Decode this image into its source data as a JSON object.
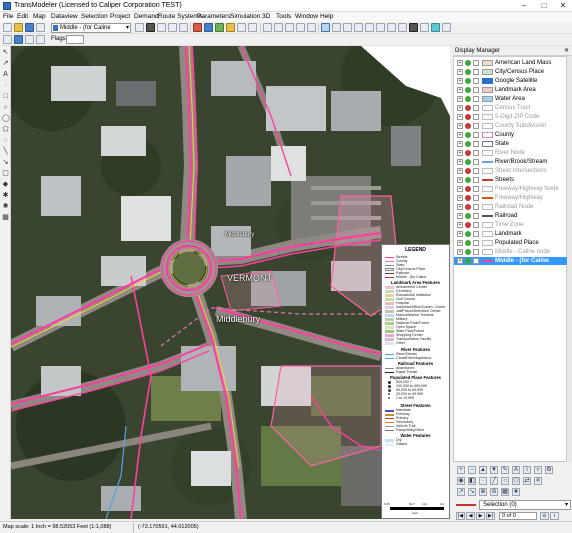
{
  "app": {
    "title": "TransModeler (Licensed to Caliper Corporation TEST)"
  },
  "menu": [
    "File",
    "Edit",
    "Map",
    "Dataview",
    "Selection",
    "Project",
    "Demand",
    "Route Systems",
    "Parameters",
    "Simulation",
    "3D",
    "Tools",
    "Window",
    "Help"
  ],
  "toolbar": {
    "layer_selected": "Middle - (for Caline",
    "flags_label": "Flags:"
  },
  "map": {
    "labels": {
      "vermont": "VERMONT",
      "middlebury": "Middlebury",
      "midbury_small": "Middlebury"
    }
  },
  "legend": {
    "title": "LEGEND",
    "top_items": [
      "Streets",
      "County",
      "State",
      "City/Census Place",
      "Railroad",
      "Middle - (for Caline"
    ],
    "landmark_title": "Landmark Area Features",
    "landmark_items": [
      "Amusement Center",
      "Cemetery",
      "Educational Institution",
      "Golf Course",
      "Hospital",
      "Industrial/Office/Comm. Center",
      "Jail/Prison/Detention Center",
      "Marina/Marine Terminal",
      "Military",
      "National Park/Forest",
      "Open Space",
      "State Park/Forest",
      "Shopping Center",
      "Transportation Facility",
      "Other"
    ],
    "river_title": "River Features",
    "river_items": [
      "River/Stream",
      "Canal/Ditch/Aqueduct"
    ],
    "railroad_title": "Railroad Features",
    "railroad_items": [
      "Abandoned",
      "Rapid Transit"
    ],
    "place_title": "Populated Place Features",
    "place_items": [
      "500,000 +",
      "100,000 to 499,999",
      "50,000 to 99,999",
      "20,000 to 49,999",
      "1 to 19,999"
    ],
    "street_title": "Street Features",
    "street_items": [
      "Interstate",
      "Freeway",
      "Primary",
      "Secondary",
      "Vehicle Trail",
      "Ramp/Alley/Other"
    ],
    "water_title": "Water Features",
    "water_items": [
      "Dry",
      "Glacier"
    ],
    "scale_ticks": [
      "0.05",
      "60.7",
      "121",
      "0.4"
    ],
    "scale_unit": "Feet"
  },
  "display_manager": {
    "title": "Display Manager",
    "layers": [
      {
        "name": "American Land Mass",
        "on": true,
        "dim": false,
        "sym": "#e8e0c8"
      },
      {
        "name": "City/Census Place",
        "on": true,
        "dim": false,
        "sym": "#cfe2cf"
      },
      {
        "name": "Google Satellite",
        "on": true,
        "dim": false,
        "sym": "#2a72c7"
      },
      {
        "name": "Landmark Area",
        "on": true,
        "dim": false,
        "sym": "#f4c9c9"
      },
      {
        "name": "Water Area",
        "on": true,
        "dim": false,
        "sym": "#9dd1ec"
      },
      {
        "name": "Census Tract",
        "on": false,
        "dim": true,
        "sym": "#ffffff"
      },
      {
        "name": "5-Digit ZIP Code",
        "on": false,
        "dim": true,
        "sym": "#ffffff"
      },
      {
        "name": "County Subdivision",
        "on": false,
        "dim": true,
        "sym": "#ffffff"
      },
      {
        "name": "County",
        "on": true,
        "dim": false,
        "sym": "#ffffff"
      },
      {
        "name": "State",
        "on": true,
        "dim": false,
        "sym": "#ffffff"
      },
      {
        "name": "River Node",
        "on": false,
        "dim": true,
        "sym": "#ffffff"
      },
      {
        "name": "River/Brook/Stream",
        "on": true,
        "dim": false,
        "sym": "#6aa7e0"
      },
      {
        "name": "Street Intersections",
        "on": false,
        "dim": true,
        "sym": "#ffffff"
      },
      {
        "name": "Streets",
        "on": true,
        "dim": false,
        "sym": "#c0392b"
      },
      {
        "name": "Freeway/Highway Node",
        "on": false,
        "dim": true,
        "sym": "#ffffff"
      },
      {
        "name": "Freeway/Highway",
        "on": false,
        "dim": true,
        "sym": "#d35400"
      },
      {
        "name": "Railroad Node",
        "on": false,
        "dim": true,
        "sym": "#ffffff"
      },
      {
        "name": "Railroad",
        "on": true,
        "dim": false,
        "sym": "#555555"
      },
      {
        "name": "Time Zone",
        "on": false,
        "dim": true,
        "sym": "#ffffff"
      },
      {
        "name": "Landmark",
        "on": true,
        "dim": false,
        "sym": "#ffffff"
      },
      {
        "name": "Populated Place",
        "on": true,
        "dim": false,
        "sym": "#ffffff"
      },
      {
        "name": "Middle - Caline node",
        "on": false,
        "dim": true,
        "sym": "#ffffff"
      },
      {
        "name": "Middle - (for Caline",
        "on": true,
        "dim": false,
        "sym": "#c0392b",
        "selected": true
      }
    ]
  },
  "selection": {
    "label": "Selection (0)",
    "count_text": "0 of 0"
  },
  "status": {
    "scale": "Map scale: 1 Inch = 98.52053 Feet (1:1,088)",
    "coordinates": "(-73.170591, 44.012005)"
  }
}
